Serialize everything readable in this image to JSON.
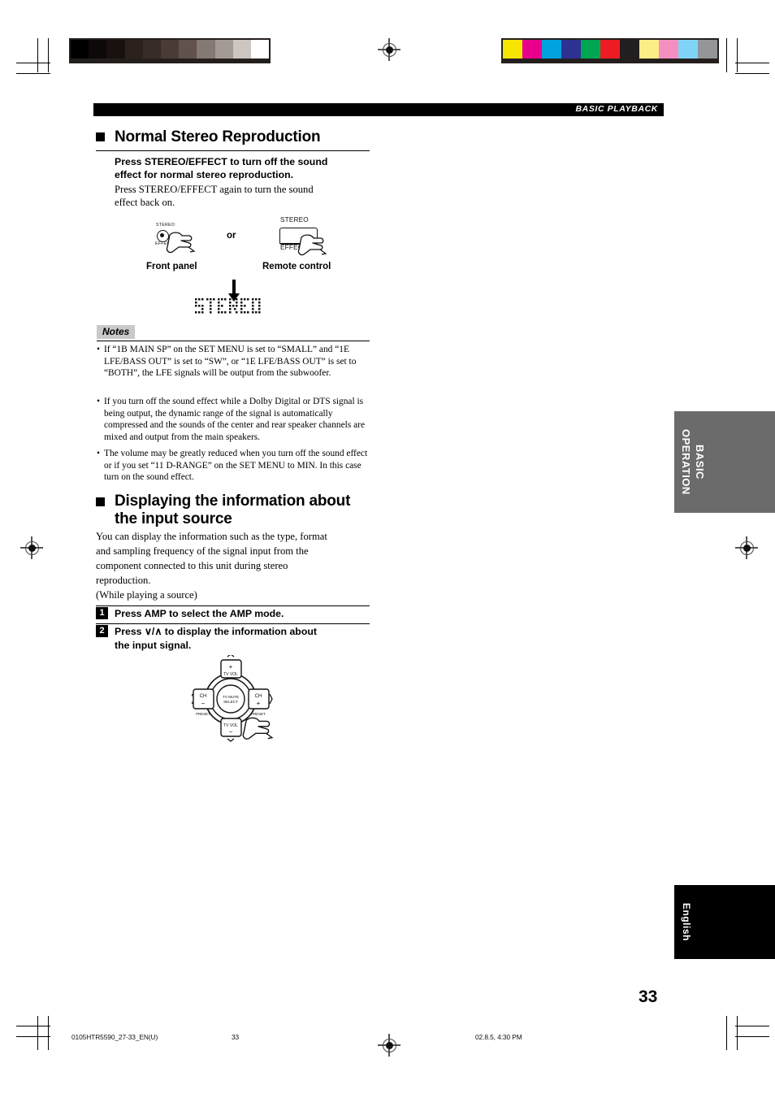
{
  "header": {
    "section_label": "BASIC PLAYBACK"
  },
  "section1": {
    "heading": "Normal Stereo Reproduction",
    "lead_line1": "Press STEREO/EFFECT to turn off the sound",
    "lead_line2": "effect for normal stereo reproduction.",
    "body_line1": "Press STEREO/EFFECT again to turn the sound",
    "body_line2": "effect back on.",
    "diagram": {
      "front_panel_caption": "Front panel",
      "remote_caption": "Remote control",
      "or_label": "or",
      "front_top_label": "STEREO",
      "front_bottom_label": "EFFECT",
      "remote_top_label": "STEREO",
      "remote_bottom_label": "EFFECT",
      "display_text": "STEREO"
    }
  },
  "notes": {
    "title": "Notes",
    "items": [
      "If “1B MAIN SP” on the SET MENU is set to “SMALL” and “1E LFE/BASS OUT” is set to “SW”, or “1E LFE/BASS OUT” is set to “BOTH”, the LFE signals will be output from the subwoofer.",
      "If you turn off the sound effect while a Dolby Digital or DTS signal is being output, the dynamic range of the signal is automatically compressed and the sounds of the center and rear speaker channels are mixed and output from the main speakers.",
      "The volume may be greatly reduced when you turn off the sound effect or if you set “11 D-RANGE” on the SET MENU to MIN. In this case turn on the sound effect."
    ],
    "bullet": "•"
  },
  "section2": {
    "heading_line1": "Displaying the information about",
    "heading_line2": "the input source",
    "body_line1": "You can display the information such as the type, format",
    "body_line2": "and sampling frequency of the signal input from the",
    "body_line3": "component connected to this unit during stereo",
    "body_line4": "reproduction.",
    "body_line5": "(While playing a source)",
    "steps": [
      {
        "number": "1",
        "text_line1": "Press AMP to select the AMP mode.",
        "text_line2": ""
      },
      {
        "number": "2",
        "text_line1": "Press ∨/∧ to display the information about",
        "text_line2": "the input signal."
      }
    ],
    "remote_diagram": {
      "up_symbol": "∧",
      "down_symbol": "∨",
      "left_symbol": "〈",
      "right_symbol": "〉",
      "top_plus": "+",
      "top_label": "TV VOL",
      "bottom_label": "TV VOL",
      "bottom_minus": "−",
      "left_label": "CH",
      "left_sign": "−",
      "right_label": "CH",
      "right_sign": "+",
      "left_preset": "PRESET",
      "right_preset": "PRESET",
      "center_line1": "TV MUTE",
      "center_line2": "SELECT"
    }
  },
  "side_tabs": {
    "operation_tab_line1": "BASIC",
    "operation_tab_line2": "OPERATION",
    "language_tab": "English"
  },
  "page_number": "33",
  "footer": {
    "file_name": "0105HTR5590_27-33_EN(U)",
    "page": "33",
    "timestamp": "02.8.5, 4:30 PM"
  },
  "colors": {
    "accent_black": "#000000",
    "notes_tag_bg": "#c9c9c9",
    "tab_gray": "#6b6b6b",
    "tab_black": "#000000",
    "grayscale_strip": [
      "#000000",
      "#0d0908",
      "#19110f",
      "#2b211d",
      "#372c27",
      "#4b3b35",
      "#61524c",
      "#857974",
      "#a39a95",
      "#cdc5c1",
      "#ffffff"
    ],
    "color_strip": [
      "#f5e500",
      "#e8008c",
      "#00a3e0",
      "#2e3192",
      "#00a651",
      "#ed1c24",
      "#231f20",
      "#fced87",
      "#f58fc2",
      "#7fd4f5",
      "#939598"
    ]
  }
}
